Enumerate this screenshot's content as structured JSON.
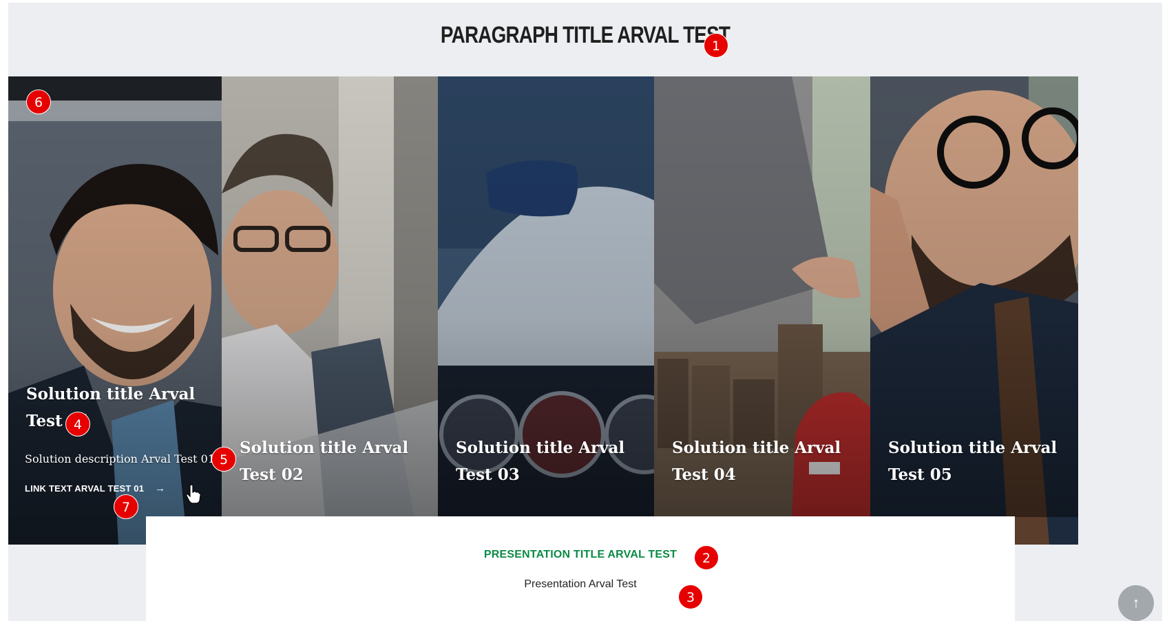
{
  "section": {
    "title": "PARAGRAPH TITLE ARVAL TEST"
  },
  "panels": [
    {
      "title": "Solution title Arval Test 01",
      "description": "Solution description Arval Test 01",
      "link": "LINK TEXT ARVAL TEST 01",
      "link_arrow": "→"
    },
    {
      "title": "Solution title Arval Test 02"
    },
    {
      "title": "Solution title Arval Test 03"
    },
    {
      "title": "Solution title Arval Test 04"
    },
    {
      "title": "Solution title Arval Test 05"
    }
  ],
  "presentation": {
    "title": "PRESENTATION TITLE ARVAL TEST",
    "text": "Presentation Arval Test"
  },
  "markers": [
    "1",
    "2",
    "3",
    "4",
    "5",
    "6",
    "7"
  ],
  "scroll_top": {
    "icon": "arrow-up-icon",
    "glyph": "↑"
  },
  "colors": {
    "accent_green": "#0b8a45",
    "marker_red": "#e60000",
    "section_bg": "#eceef1"
  }
}
